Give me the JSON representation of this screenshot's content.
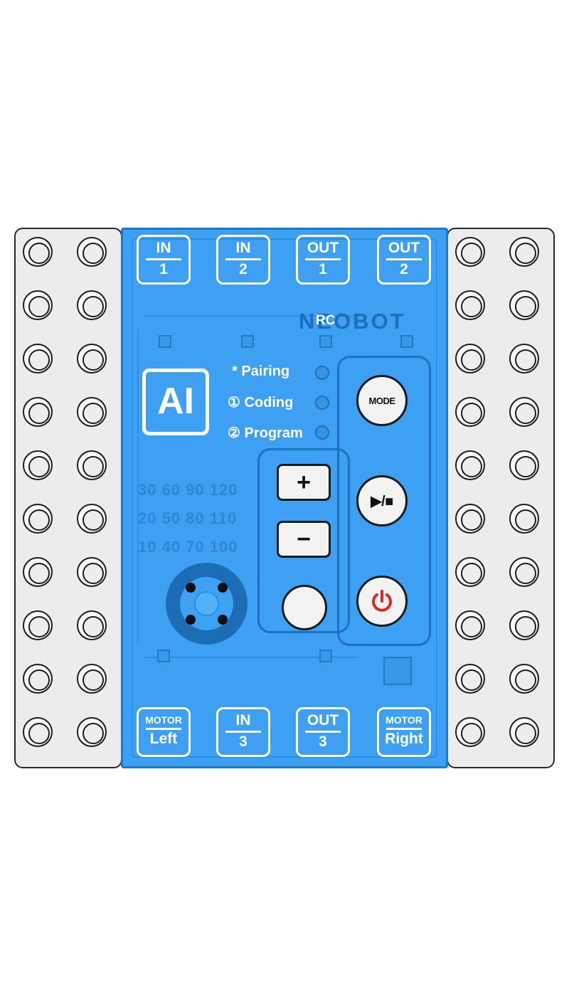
{
  "ports_top": [
    {
      "top": "IN",
      "bottom": "1"
    },
    {
      "top": "IN",
      "bottom": "2"
    },
    {
      "top": "OUT",
      "bottom": "1"
    },
    {
      "top": "OUT",
      "bottom": "2"
    }
  ],
  "ports_bottom": [
    {
      "top": "MOTOR",
      "bottom": "Left"
    },
    {
      "top": "IN",
      "bottom": "3"
    },
    {
      "top": "OUT",
      "bottom": "3"
    },
    {
      "top": "MOTOR",
      "bottom": "Right"
    }
  ],
  "brand": {
    "name": "NEOBOT",
    "sub": "RC"
  },
  "ai_badge": "AI",
  "modes": [
    "* Pairing",
    "① Coding",
    "② Program"
  ],
  "buttons": {
    "mode": "MODE",
    "plus": "+",
    "minus": "−",
    "play_stop": "▶/■",
    "power": "⏻"
  },
  "speed_rows": [
    "30 60 90 120",
    "20 50 80 110",
    "10 40 70 100"
  ],
  "colors": {
    "board": "#3da0f2",
    "power": "#e0262c",
    "frame": "#ececec"
  },
  "icons": [
    "power-icon",
    "play-stop-icon",
    "plus-icon",
    "minus-icon",
    "ir-receiver-icon"
  ]
}
